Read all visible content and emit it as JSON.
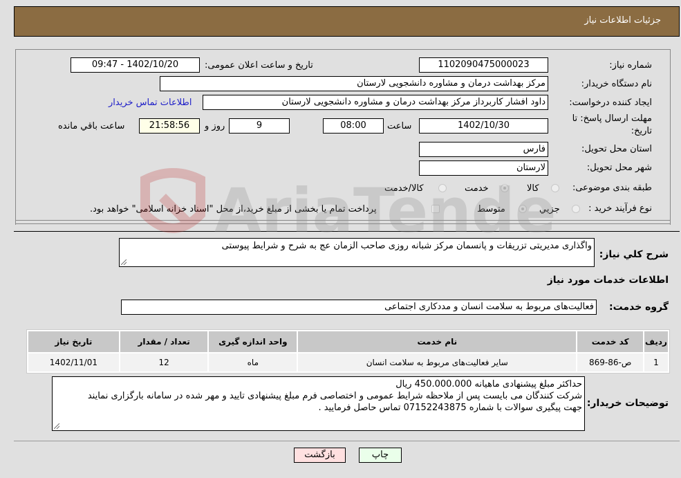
{
  "header": {
    "title": "جزئیات اطلاعات نیاز"
  },
  "form": {
    "need_number_label": "شماره نیاز:",
    "need_number": "1102090475000023",
    "announce_label": "تاریخ و ساعت اعلان عمومی:",
    "announce_value": "1402/10/20 - 09:47",
    "buyer_org_label": "نام دستگاه خریدار:",
    "buyer_org": "مرکز بهداشت  درمان و مشاوره دانشجویی لارستان",
    "creator_label": "ایجاد کننده درخواست:",
    "creator": "داود افشار کاربرداز مرکز بهداشت  درمان و مشاوره دانشجویی لارستان",
    "buyer_contact_link": "اطلاعات تماس خریدار",
    "deadline_label_line1": "مهلت ارسال پاسخ: تا",
    "deadline_label_line2": "تاریخ:",
    "deadline_date": "1402/10/30",
    "time_label": "ساعت",
    "deadline_time": "08:00",
    "days_value": "9",
    "days_label": "روز و",
    "remaining_time": "21:58:56",
    "remaining_label": "ساعت باقي مانده",
    "province_label": "استان محل تحویل:",
    "province": "فارس",
    "city_label": "شهر محل تحویل:",
    "city": "لارستان",
    "category_label": "طبقه بندی موضوعی:",
    "category_options": [
      {
        "label": "کالا",
        "checked": false
      },
      {
        "label": "خدمت",
        "checked": true
      },
      {
        "label": "کالا/خدمت",
        "checked": false
      }
    ],
    "process_label": "نوع فرآیند خرید :",
    "process_options": [
      {
        "label": "جزيي",
        "checked": false
      },
      {
        "label": "متوسط",
        "checked": true
      }
    ],
    "treasury_checkbox_label": "پرداخت تمام یا بخشی از مبلغ خرید،از محل \"اسناد خزانه اسلامی\" خواهد بود."
  },
  "description": {
    "label": "شرح كلي نياز:",
    "value": "واگذاری مدیریتی تزریقات و پانسمان مرکز شبانه روزی صاحب الزمان عج به شرح و شرایط پیوستی"
  },
  "services_section": {
    "title": "اطلاعات خدمات مورد نياز",
    "group_label": "گروه خدمت:",
    "group_value": "فعالیت‌های مربوط به سلامت انسان و مددکاری اجتماعی"
  },
  "table": {
    "headers": [
      "رديف",
      "کد خدمت",
      "نام خدمت",
      "واحد اندازه گیری",
      "تعداد / مقدار",
      "تاریخ نیاز"
    ],
    "rows": [
      [
        "1",
        "ص-86-869",
        "سایر فعالیت‌های مربوط به سلامت انسان",
        "ماه",
        "12",
        "1402/11/01"
      ]
    ]
  },
  "buyer_notes": {
    "label": "توضیحات خریدار:",
    "lines": [
      "حداکثر مبلغ پیشنهادی ماهیانه 450.000.000 ریال",
      "شرکت کنندگان می بایست پس از ملاحظه شرایط عمومی و اختصاصی فرم مبلغ پیشنهادی تایید و مهر شده در سامانه بارگزاری نمایند",
      "جهت پیگیری سوالات با شماره  07152243875 تماس حاصل فرمایید ."
    ]
  },
  "buttons": {
    "print": "چاپ",
    "back": "بازگشت"
  },
  "colors": {
    "header_bg": "#8b6c42",
    "link": "#2020c8",
    "print_bg": "#eaffea",
    "back_bg": "#ffe0e0"
  },
  "watermark": {
    "text": "AriaTender.neT"
  }
}
